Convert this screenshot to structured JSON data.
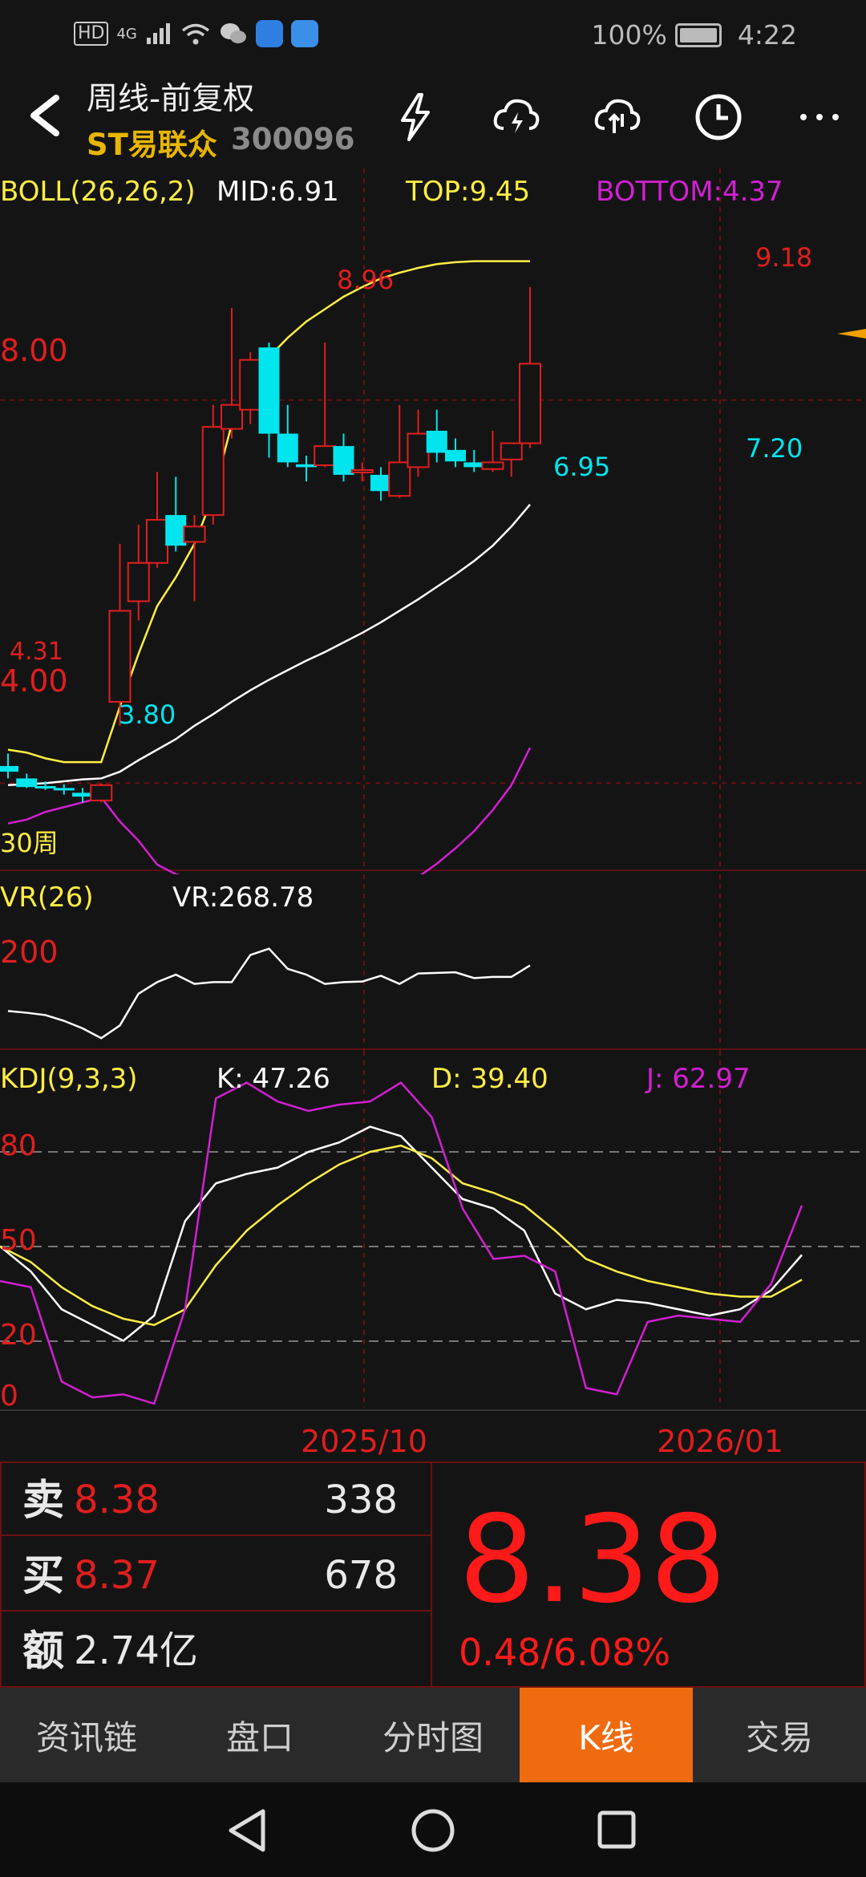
{
  "status_bar": {
    "hd": "HD",
    "signal": "4G",
    "battery": "100%",
    "time": "4:22"
  },
  "header": {
    "title": "周线-前复权",
    "stock_name": "ST易联众",
    "stock_code": "300096",
    "icons": [
      "back-arrow-icon",
      "lightning-icon",
      "cloud-download-icon",
      "cloud-upload-icon",
      "clock-icon",
      "more-icon"
    ]
  },
  "indicators": {
    "boll": {
      "name": "BOLL(26,26,2)",
      "mid": "MID:6.91",
      "top": "TOP:9.45",
      "bottom": "BOTTOM:4.37"
    },
    "vr": {
      "name": "VR(26)",
      "value": "VR:268.78"
    },
    "kdj": {
      "name": "KDJ(9,3,3)",
      "k": "K: 47.26",
      "d": "D: 39.40",
      "j": "J: 62.97"
    }
  },
  "colors": {
    "up": "#e01e1e",
    "down": "#00e5ee",
    "top": "#ffee44",
    "mid": "#ffffff",
    "bottom": "#d21fd2",
    "price_red": "#ff1a1a",
    "tab_active": "#f06a0f",
    "grid": "#6a1010"
  },
  "chart_data": [
    {
      "type": "candlestick",
      "title": "BOLL(26,26,2)",
      "period_label": "30周",
      "y_labels": [
        "8.00",
        "4.00"
      ],
      "price_annotations": [
        "8.96",
        "9.18",
        "6.95",
        "7.20",
        "4.31",
        "3.80"
      ],
      "x_labels": [
        "2025/10",
        "2026/01"
      ],
      "ylim": [
        3.3,
        10.0
      ],
      "candles": [
        {
          "o": 4.18,
          "h": 4.31,
          "l": 4.05,
          "c": 4.12
        },
        {
          "o": 4.05,
          "h": 4.1,
          "l": 3.95,
          "c": 3.96
        },
        {
          "o": 3.97,
          "h": 4.02,
          "l": 3.93,
          "c": 3.95
        },
        {
          "o": 3.95,
          "h": 3.99,
          "l": 3.88,
          "c": 3.93
        },
        {
          "o": 3.9,
          "h": 3.95,
          "l": 3.8,
          "c": 3.86
        },
        {
          "o": 3.82,
          "h": 4.0,
          "l": 3.8,
          "c": 3.98
        },
        {
          "o": 4.85,
          "h": 6.5,
          "l": 4.6,
          "c": 5.8
        },
        {
          "o": 5.9,
          "h": 6.7,
          "l": 5.7,
          "c": 6.3
        },
        {
          "o": 6.3,
          "h": 7.25,
          "l": 6.25,
          "c": 6.75
        },
        {
          "o": 6.8,
          "h": 7.2,
          "l": 6.42,
          "c": 6.48
        },
        {
          "o": 6.52,
          "h": 6.8,
          "l": 5.9,
          "c": 6.68
        },
        {
          "o": 6.8,
          "h": 7.95,
          "l": 6.7,
          "c": 7.72
        },
        {
          "o": 7.7,
          "h": 8.96,
          "l": 7.6,
          "c": 7.95
        },
        {
          "o": 7.9,
          "h": 8.5,
          "l": 7.75,
          "c": 8.42
        },
        {
          "o": 8.55,
          "h": 8.6,
          "l": 7.4,
          "c": 7.65
        },
        {
          "o": 7.65,
          "h": 7.95,
          "l": 7.3,
          "c": 7.35
        },
        {
          "o": 7.33,
          "h": 7.42,
          "l": 7.15,
          "c": 7.3
        },
        {
          "o": 7.32,
          "h": 8.6,
          "l": 7.3,
          "c": 7.52
        },
        {
          "o": 7.52,
          "h": 7.65,
          "l": 7.15,
          "c": 7.22
        },
        {
          "o": 7.25,
          "h": 7.35,
          "l": 7.15,
          "c": 7.27
        },
        {
          "o": 7.22,
          "h": 7.3,
          "l": 6.95,
          "c": 7.05
        },
        {
          "o": 7.0,
          "h": 7.95,
          "l": 6.98,
          "c": 7.35
        },
        {
          "o": 7.3,
          "h": 7.9,
          "l": 7.2,
          "c": 7.65
        },
        {
          "o": 7.68,
          "h": 7.9,
          "l": 7.35,
          "c": 7.45
        },
        {
          "o": 7.48,
          "h": 7.6,
          "l": 7.3,
          "c": 7.36
        },
        {
          "o": 7.35,
          "h": 7.48,
          "l": 7.25,
          "c": 7.3
        },
        {
          "o": 7.28,
          "h": 7.68,
          "l": 7.25,
          "c": 7.35
        },
        {
          "o": 7.38,
          "h": 7.55,
          "l": 7.2,
          "c": 7.55
        },
        {
          "o": 7.55,
          "h": 9.18,
          "l": 7.5,
          "c": 8.38
        }
      ],
      "top": [
        4.35,
        4.32,
        4.26,
        4.22,
        4.22,
        4.22,
        4.8,
        5.35,
        5.85,
        6.15,
        6.5,
        7.0,
        7.75,
        8.15,
        8.45,
        8.65,
        8.82,
        8.95,
        9.08,
        9.18,
        9.27,
        9.33,
        9.38,
        9.42,
        9.44,
        9.45,
        9.45,
        9.45,
        9.45
      ],
      "mid": [
        3.98,
        3.99,
        4.0,
        4.02,
        4.04,
        4.05,
        4.12,
        4.24,
        4.35,
        4.46,
        4.6,
        4.72,
        4.85,
        4.97,
        5.08,
        5.18,
        5.28,
        5.37,
        5.47,
        5.57,
        5.68,
        5.8,
        5.92,
        6.05,
        6.18,
        6.32,
        6.48,
        6.68,
        6.91
      ],
      "bottom": [
        3.58,
        3.62,
        3.7,
        3.75,
        3.8,
        3.85,
        3.6,
        3.4,
        3.15,
        3.05,
        3.0,
        2.85,
        2.68,
        2.58,
        2.56,
        2.58,
        2.6,
        2.62,
        2.66,
        2.72,
        2.8,
        2.9,
        3.02,
        3.16,
        3.32,
        3.5,
        3.72,
        3.98,
        4.37
      ]
    },
    {
      "type": "line",
      "title": "VR(26)",
      "y_labels": [
        "200"
      ],
      "ylim": [
        80,
        330
      ],
      "series": [
        {
          "name": "VR",
          "values": [
            135,
            132,
            128,
            118,
            105,
            88,
            110,
            165,
            185,
            198,
            182,
            185,
            185,
            232,
            243,
            208,
            198,
            182,
            185,
            186,
            196,
            182,
            200,
            201,
            202,
            192,
            194,
            194,
            214
          ]
        }
      ]
    },
    {
      "type": "line",
      "title": "KDJ(9,3,3)",
      "y_labels": [
        "80",
        "50",
        "20",
        "0"
      ],
      "ylim": [
        -8,
        100
      ],
      "series": [
        {
          "name": "K",
          "values": [
            50,
            42,
            30,
            25,
            20,
            28,
            58,
            70,
            73,
            75,
            80,
            83,
            88,
            85,
            75,
            65,
            62,
            55,
            35,
            30,
            33,
            32,
            30,
            28,
            30,
            36,
            47.26
          ]
        },
        {
          "name": "D",
          "values": [
            50,
            45,
            37,
            31,
            27,
            25,
            30,
            44,
            55,
            63,
            70,
            76,
            80,
            82,
            78,
            70,
            67,
            63,
            55,
            46,
            42,
            39,
            37,
            35,
            34,
            34,
            39.4
          ]
        },
        {
          "name": "J",
          "values": [
            39,
            37,
            7,
            2,
            3,
            0,
            30,
            97,
            102,
            96,
            93,
            95,
            96,
            102,
            91,
            62,
            46,
            47,
            42,
            5,
            3,
            26,
            28,
            27,
            26,
            38,
            62.97
          ]
        }
      ]
    }
  ],
  "quote": {
    "sell_label": "卖",
    "sell_price": "8.38",
    "sell_qty": "338",
    "buy_label": "买",
    "buy_price": "8.37",
    "buy_qty": "678",
    "amount_label": "额",
    "amount": "2.74亿",
    "last_price": "8.38",
    "change": "0.48/6.08%"
  },
  "tabs": [
    {
      "label": "资讯链",
      "active": false
    },
    {
      "label": "盘口",
      "active": false
    },
    {
      "label": "分时图",
      "active": false
    },
    {
      "label": "K线",
      "active": true
    },
    {
      "label": "交易",
      "active": false
    }
  ],
  "navbar": [
    "back-icon",
    "home-icon",
    "recents-icon"
  ]
}
